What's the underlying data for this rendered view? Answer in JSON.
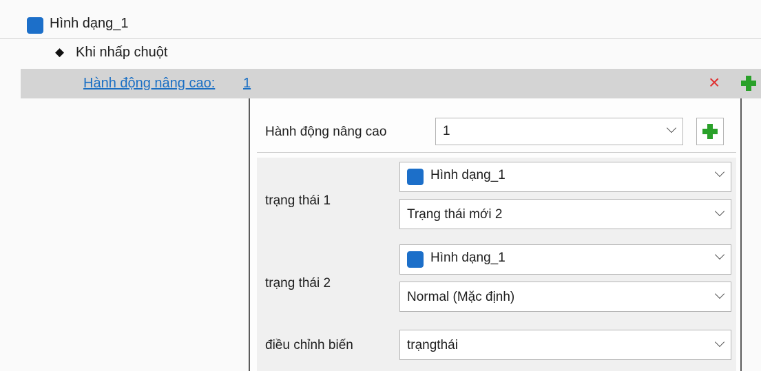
{
  "tree": {
    "shape_label": "Hình dạng_1",
    "event_label": "Khi nhấp chuột",
    "advanced_link": "Hành động nâng cao:",
    "advanced_number": "1",
    "delete_glyph": "×"
  },
  "panel": {
    "header_label": "Hành động nâng cao",
    "header_select_value": "1",
    "state1": {
      "label": "trạng thái 1",
      "object": "Hình dạng_1",
      "state": "Trạng thái mới 2"
    },
    "state2": {
      "label": "trạng thái 2",
      "object": "Hình dạng_1",
      "state": "Normal (Mặc định)"
    },
    "variable": {
      "label": "điều chỉnh biến",
      "value": "trạngthái"
    }
  },
  "colors": {
    "shape_swatch": "#1c6fc9",
    "link": "#1a6fc4",
    "delete": "#e03030",
    "add": "#2aa12a",
    "selected_row": "#d4d4d4"
  },
  "icons": [
    "shape-swatch-icon",
    "diamond-bullet-icon",
    "delete-x-icon",
    "add-plus-icon",
    "chevron-down-icon"
  ]
}
